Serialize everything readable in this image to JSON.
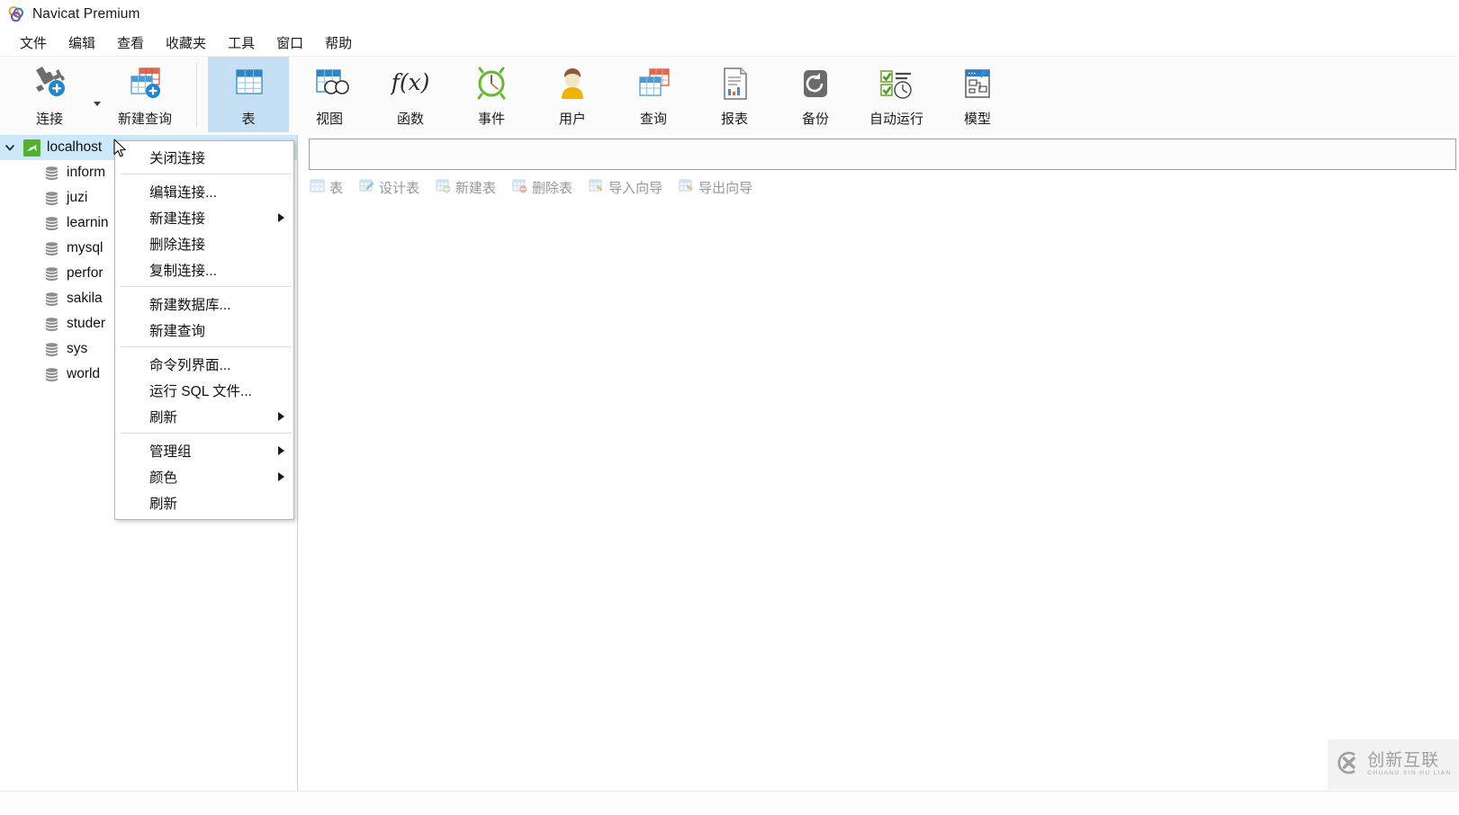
{
  "window": {
    "title": "Navicat Premium",
    "logo_icon": "navicat-logo-icon"
  },
  "menubar": {
    "items": [
      {
        "label": "文件",
        "name": "menu-file"
      },
      {
        "label": "编辑",
        "name": "menu-edit"
      },
      {
        "label": "查看",
        "name": "menu-view"
      },
      {
        "label": "收藏夹",
        "name": "menu-favorites"
      },
      {
        "label": "工具",
        "name": "menu-tools"
      },
      {
        "label": "窗口",
        "name": "menu-window"
      },
      {
        "label": "帮助",
        "name": "menu-help"
      }
    ]
  },
  "ribbon": {
    "buttons": [
      {
        "label": "连接",
        "icon": "connection-plug-icon",
        "active": false
      },
      {
        "label": "新建查询",
        "icon": "new-query-icon",
        "active": false
      },
      {
        "label": "表",
        "icon": "table-icon",
        "active": true
      },
      {
        "label": "视图",
        "icon": "view-icon",
        "active": false
      },
      {
        "label": "函数",
        "icon": "function-fx-icon",
        "active": false
      },
      {
        "label": "事件",
        "icon": "event-clock-icon",
        "active": false
      },
      {
        "label": "用户",
        "icon": "user-icon",
        "active": false
      },
      {
        "label": "查询",
        "icon": "query-icon",
        "active": false
      },
      {
        "label": "报表",
        "icon": "report-icon",
        "active": false
      },
      {
        "label": "备份",
        "icon": "backup-icon",
        "active": false
      },
      {
        "label": "自动运行",
        "icon": "automation-icon",
        "active": false
      },
      {
        "label": "模型",
        "icon": "model-icon",
        "active": false
      }
    ]
  },
  "sidebar": {
    "connection": {
      "label": "localhost",
      "icon": "mysql-dolphin-icon",
      "expanded": true,
      "selected": true
    },
    "databases": [
      {
        "label": "inform",
        "icon": "database-icon"
      },
      {
        "label": "juzi",
        "icon": "database-icon"
      },
      {
        "label": "learnin",
        "icon": "database-icon"
      },
      {
        "label": "mysql",
        "icon": "database-icon"
      },
      {
        "label": "perfor",
        "icon": "database-icon"
      },
      {
        "label": "sakila",
        "icon": "database-icon"
      },
      {
        "label": "studer",
        "icon": "database-icon"
      },
      {
        "label": "sys",
        "icon": "database-icon"
      },
      {
        "label": "world",
        "icon": "database-icon"
      }
    ]
  },
  "content": {
    "filter_value": "",
    "filter_placeholder": "",
    "object_toolbar": [
      {
        "label": "表",
        "icon": "open-table-icon",
        "truncated": true
      },
      {
        "label": "设计表",
        "icon": "design-table-icon",
        "truncated": false
      },
      {
        "label": "新建表",
        "icon": "new-table-icon",
        "truncated": false
      },
      {
        "label": "删除表",
        "icon": "delete-table-icon",
        "truncated": false
      },
      {
        "label": "导入向导",
        "icon": "import-wizard-icon",
        "truncated": false
      },
      {
        "label": "导出向导",
        "icon": "export-wizard-icon",
        "truncated": false
      }
    ]
  },
  "context_menu": {
    "groups": [
      [
        {
          "label": "关闭连接",
          "submenu": false
        }
      ],
      [
        {
          "label": "编辑连接...",
          "submenu": false
        },
        {
          "label": "新建连接",
          "submenu": true
        },
        {
          "label": "删除连接",
          "submenu": false
        },
        {
          "label": "复制连接...",
          "submenu": false
        }
      ],
      [
        {
          "label": "新建数据库...",
          "submenu": false
        },
        {
          "label": "新建查询",
          "submenu": false
        }
      ],
      [
        {
          "label": "命令列界面...",
          "submenu": false
        },
        {
          "label": "运行 SQL 文件...",
          "submenu": false
        },
        {
          "label": "刷新",
          "submenu": true
        }
      ],
      [
        {
          "label": "管理组",
          "submenu": true
        },
        {
          "label": "颜色",
          "submenu": true
        },
        {
          "label": "刷新",
          "submenu": false
        }
      ]
    ]
  },
  "watermark": {
    "cn": "创新互联",
    "pinyin": "CHUANG XIN HU LIAN",
    "icon": "cx-logo-icon"
  },
  "colors": {
    "accent_blue": "#1e88d2",
    "selection_blue": "#cde8fa",
    "ribbon_active": "#c5e0f5",
    "mysql_green": "#5cb130",
    "disabled_text": "#9aa3ab"
  }
}
